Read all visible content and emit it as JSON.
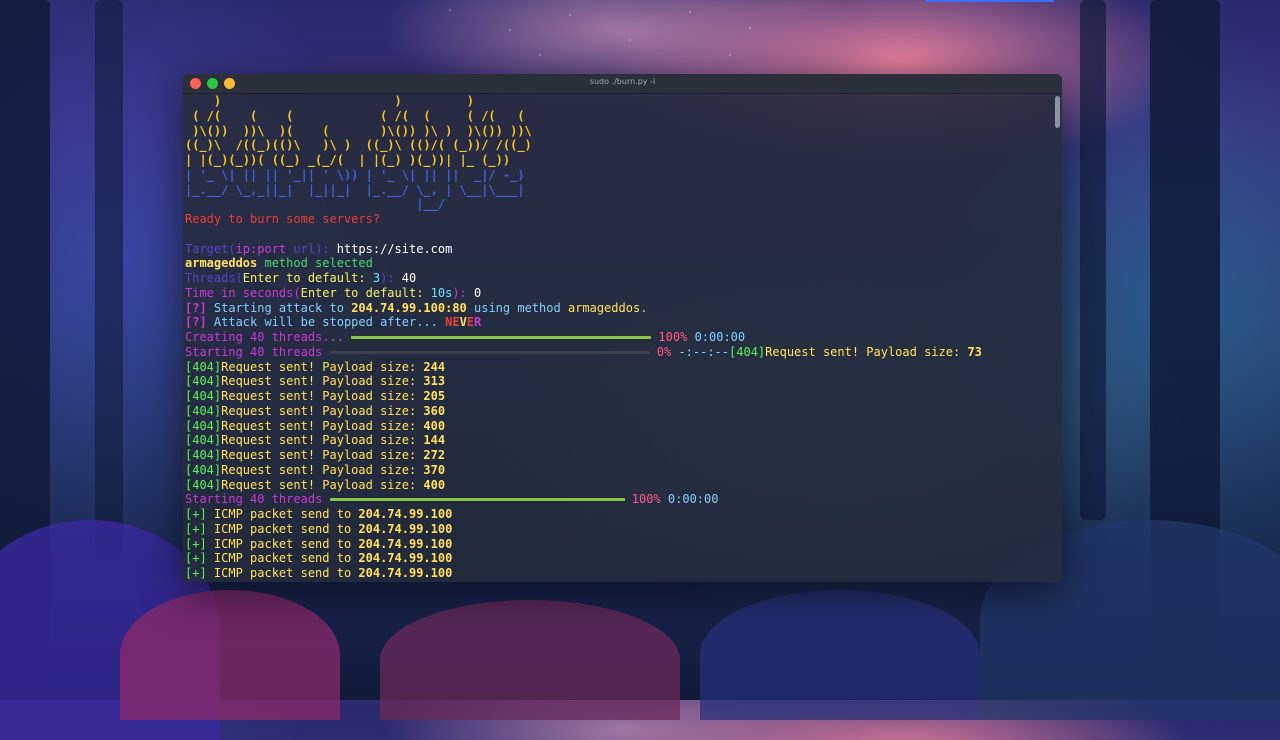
{
  "window": {
    "title": "sudo ./burn.py -i"
  },
  "terminal": {
    "ascii_art": [
      "    )                        )         )",
      " ( /(    (    (            ( /(  (     ( /(   (",
      " )\\())  ))\\  )(    (       )\\()) )\\ )  )\\()) ))\\",
      "((_)\\  /((_)(()\\   )\\ )  ((_)\\ (()/( (_))/ /((_)",
      "| |(_)(_))( ((_) _(_/(  | |(_) )(_))| |_ (_))",
      "| '_ \\| || || '_|| ' \\)) | '_ \\| || ||  _|/ -_)",
      "|_.__/ \\_,_||_|  |_||_|  |_.__/ \\_, | \\__|\\___|",
      "                                |__/"
    ],
    "ready": "Ready to burn some servers?",
    "target_prompt": {
      "pre": "Target(",
      "ip_port": "ip:port",
      "url": " url",
      "post": "): ",
      "value": "https://site.com"
    },
    "method_line": {
      "method": "armageddos",
      "suffix": " method selected"
    },
    "threads_prompt": {
      "pre": "Threads(",
      "mid": "Enter to default: ",
      "def": "3",
      "post": "): ",
      "value": "40"
    },
    "time_prompt": {
      "pre": "Time in seconds(",
      "mid": "Enter to default: ",
      "def": "10s",
      "post": "): ",
      "value": "0"
    },
    "starting_attack": {
      "tag": "[?]",
      "text1": " Starting attack to ",
      "target": "204.74.99.100:80",
      "text2": " using method ",
      "method": "armageddos",
      "text3": "."
    },
    "stop_line": {
      "tag": "[?]",
      "text": " Attack will be stopped after... ",
      "never_a": "NE",
      "never_b": "V",
      "never_c": "E",
      "never_d": "R"
    },
    "creating": {
      "label": "Creating 40 threads...",
      "percent": "100%",
      "time": "0:00:00",
      "progress": 1.0
    },
    "starting_threads_1": {
      "label": "Starting 40 threads",
      "percent": "0%",
      "time": "-:--:--",
      "tag": "[404]",
      "msg": "Request sent! Payload size: ",
      "size": "73",
      "progress": 0.0
    },
    "requests": [
      {
        "tag": "[404]",
        "msg": "Request sent! Payload size: ",
        "size": "244"
      },
      {
        "tag": "[404]",
        "msg": "Request sent! Payload size: ",
        "size": "313"
      },
      {
        "tag": "[404]",
        "msg": "Request sent! Payload size: ",
        "size": "205"
      },
      {
        "tag": "[404]",
        "msg": "Request sent! Payload size: ",
        "size": "360"
      },
      {
        "tag": "[404]",
        "msg": "Request sent! Payload size: ",
        "size": "400"
      },
      {
        "tag": "[404]",
        "msg": "Request sent! Payload size: ",
        "size": "144"
      },
      {
        "tag": "[404]",
        "msg": "Request sent! Payload size: ",
        "size": "272"
      },
      {
        "tag": "[404]",
        "msg": "Request sent! Payload size: ",
        "size": "370"
      },
      {
        "tag": "[404]",
        "msg": "Request sent! Payload size: ",
        "size": "400"
      }
    ],
    "starting_threads_2": {
      "label": "Starting 40 threads",
      "percent": "100%",
      "time": "0:00:00",
      "progress": 1.0
    },
    "icmp": [
      {
        "tag": "[+]",
        "msg": " ICMP packet send to ",
        "ip": "204.74.99.100"
      },
      {
        "tag": "[+]",
        "msg": " ICMP packet send to ",
        "ip": "204.74.99.100"
      },
      {
        "tag": "[+]",
        "msg": " ICMP packet send to ",
        "ip": "204.74.99.100"
      },
      {
        "tag": "[+]",
        "msg": " ICMP packet send to ",
        "ip": "204.74.99.100"
      },
      {
        "tag": "[+]",
        "msg": " ICMP packet send to ",
        "ip": "204.74.99.100"
      }
    ]
  },
  "colors": {
    "window_bg": "#242a38",
    "titlebar": "#2a2f3a",
    "bar_green": "#8bc34a"
  }
}
